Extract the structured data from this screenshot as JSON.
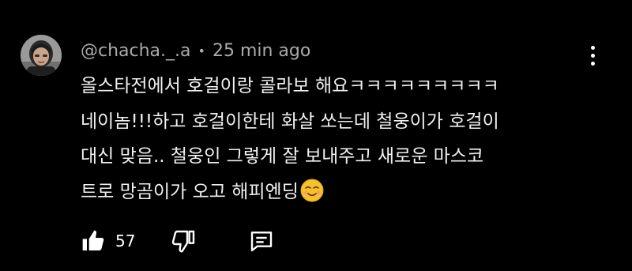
{
  "comment": {
    "author_handle": "@chacha._.a",
    "separator": "•",
    "timestamp": "25 min ago",
    "lines": [
      "올스타전에서 호걸이랑 콜라보 해요ㅋㅋㅋㅋㅋㅋㅋㅋㅋ",
      "네이놈!!!하고 호걸이한테 화살 쏘는데 철웅이가 호걸이",
      "대신 맞음.. 철웅인 그렇게 잘 보내주고 새로운 마스코",
      "트로 망곰이가 오고 해피엔딩"
    ],
    "emoji_icon": "smiling-face-emoji",
    "like_count": "57"
  },
  "icons": {
    "avatar": "user-avatar",
    "menu": "more-vertical-icon",
    "like": "thumbs-up-icon",
    "dislike": "thumbs-down-icon",
    "reply": "reply-comment-icon"
  },
  "colors": {
    "background": "#000000",
    "meta_text": "#aaaaaa",
    "body_text": "#f1f1f1"
  }
}
